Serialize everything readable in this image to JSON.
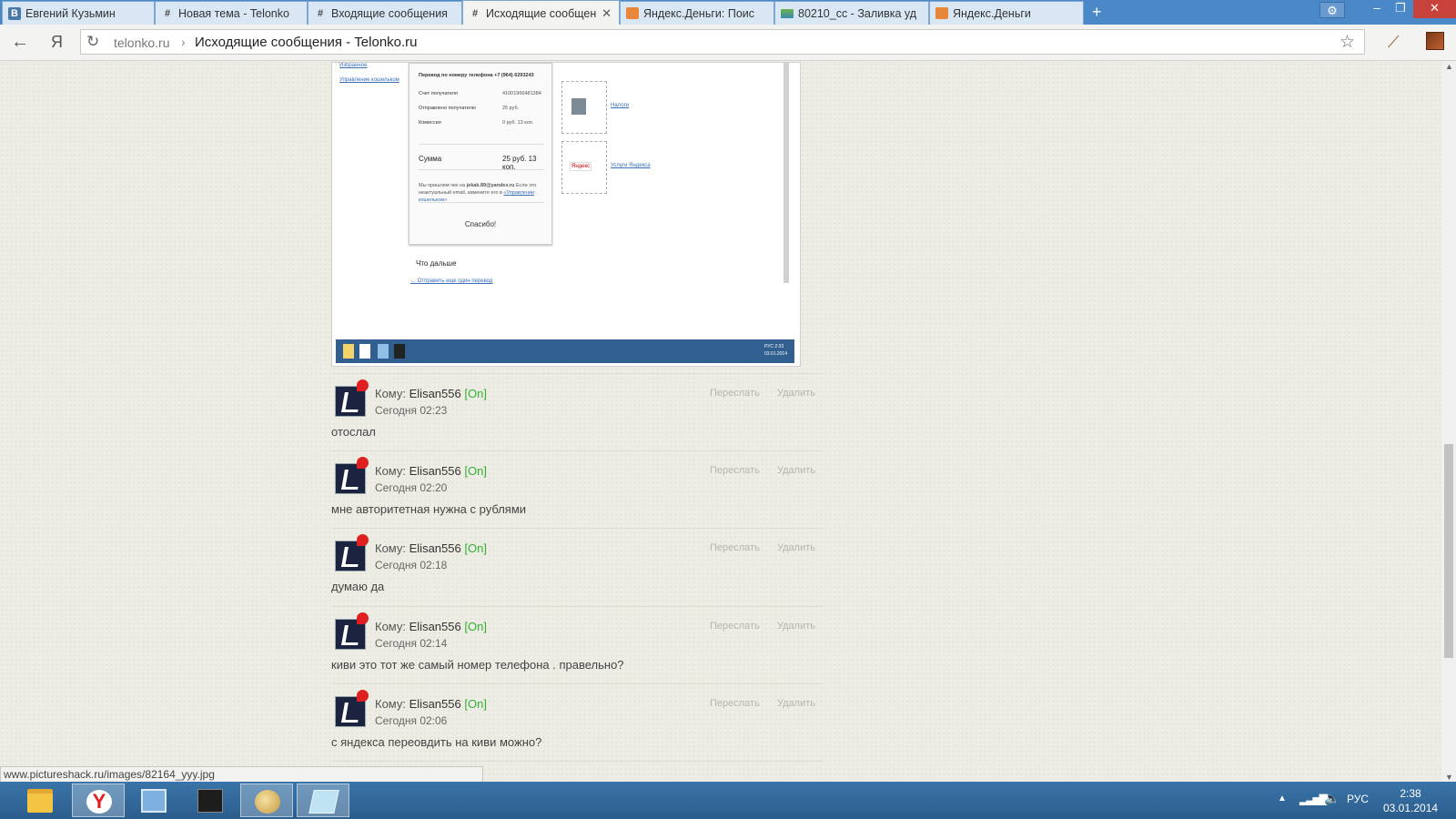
{
  "tabs": [
    {
      "title": "Евгений Кузьмин",
      "favicon": "vk-icon",
      "active": false
    },
    {
      "title": "Новая тема - Telonko",
      "favicon": "hash-icon",
      "active": false
    },
    {
      "title": "Входящие сообщения",
      "favicon": "hash-icon",
      "active": false
    },
    {
      "title": "Исходящие сообщен",
      "favicon": "hash-icon",
      "active": true
    },
    {
      "title": "Яндекс.Деньги: Поис",
      "favicon": "wallet-icon",
      "active": false
    },
    {
      "title": "80210_cc - Заливка уд",
      "favicon": "image-icon",
      "active": false
    },
    {
      "title": "Яндекс.Деньги",
      "favicon": "wallet-icon",
      "active": false
    }
  ],
  "window_controls": {
    "new_tab": "+",
    "settings": "⚙",
    "minimize": "–",
    "maximize": "❐",
    "close": "✕"
  },
  "toolbar": {
    "back": "←",
    "ya": "Я",
    "reload": "↻",
    "star": "☆"
  },
  "address": {
    "domain": "telonko.ru",
    "separator": "›",
    "page_title": "Исходящие сообщения - Telonko.ru"
  },
  "embedded_screenshot": {
    "side_links": [
      "Избранное",
      "Управление кошельком"
    ],
    "receipt": {
      "heading": "Перевод по номеру телефона +7 (964) 6293243",
      "rows": [
        {
          "label": "Счет получателя",
          "value": "41001966481384"
        },
        {
          "label": "Отправлено получателю",
          "value": "25 руб."
        },
        {
          "label": "Комиссия",
          "value": "0 руб. 13 коп."
        }
      ],
      "sum_label": "Сумма",
      "sum_value": "25 руб. 13 коп.",
      "note_prefix": "Мы пришлем чек на",
      "email": "jekak.89@yandex.ru",
      "note_suffix": "Если это неактуальный email, измените его в",
      "note_link": "«Управлении кошельком»",
      "thanks": "Спасибо!"
    },
    "cards": [
      {
        "link": "Налоги"
      },
      {
        "logo": "Яндекс",
        "link": "Услуги Яндекса"
      }
    ],
    "next_heading": "Что дальше",
    "next_link": "Отправить еще один перевод",
    "mini_clock": {
      "time": "2:33",
      "date": "03.01.2014"
    },
    "mini_lang": "РУС"
  },
  "messages": [
    {
      "to_label": "Кому:",
      "user": "Elisan556",
      "status": "[On]",
      "time": "Сегодня 02:23",
      "text": "отослал",
      "forward": "Переслать",
      "delete": "Удалить"
    },
    {
      "to_label": "Кому:",
      "user": "Elisan556",
      "status": "[On]",
      "time": "Сегодня 02:20",
      "text": "мне авторитетная нужна с рублями",
      "forward": "Переслать",
      "delete": "Удалить"
    },
    {
      "to_label": "Кому:",
      "user": "Elisan556",
      "status": "[On]",
      "time": "Сегодня 02:18",
      "text": "думаю да",
      "forward": "Переслать",
      "delete": "Удалить"
    },
    {
      "to_label": "Кому:",
      "user": "Elisan556",
      "status": "[On]",
      "time": "Сегодня 02:14",
      "text": "киви это тот же самый номер телефона . правельно?",
      "forward": "Переслать",
      "delete": "Удалить"
    },
    {
      "to_label": "Кому:",
      "user": "Elisan556",
      "status": "[On]",
      "time": "Сегодня 02:06",
      "text": "с яндекса переовдить на киви можно?",
      "forward": "Переслать",
      "delete": "Удалить"
    }
  ],
  "status_url": "www.pictureshack.ru/images/82164_yyy.jpg",
  "taskbar": {
    "apps": [
      "folder-icon",
      "yandex-browser-icon",
      "control-panel-icon",
      "apps-icon",
      "paint-icon",
      "notepad-icon"
    ],
    "tray": {
      "arrow": "▲",
      "signal": "▂▃▅▇",
      "volume": "🔈",
      "lang": "РУС",
      "time": "2:38",
      "date": "03.01.2014"
    }
  }
}
